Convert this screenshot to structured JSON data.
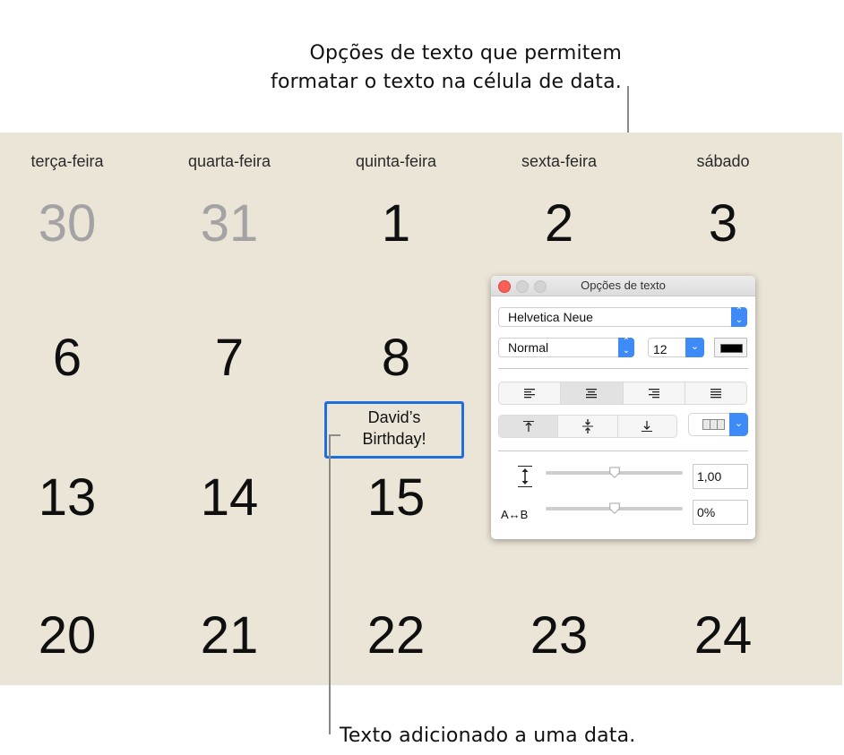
{
  "annotations": {
    "top_callout_line1": "Opções de texto que permitem",
    "top_callout_line2": "formatar o texto na célula de data.",
    "bottom_callout": "Texto adicionado a uma data."
  },
  "calendar": {
    "weekdays": [
      "terça-feira",
      "quarta-feira",
      "quinta-feira",
      "sexta-feira",
      "sábado"
    ],
    "weeks": [
      [
        {
          "day": "30",
          "dim": true
        },
        {
          "day": "31",
          "dim": true
        },
        {
          "day": "1"
        },
        {
          "day": "2"
        },
        {
          "day": "3"
        }
      ],
      [
        {
          "day": "6"
        },
        {
          "day": "7"
        },
        {
          "day": "8"
        },
        {
          "day": ""
        },
        {
          "day": ""
        }
      ],
      [
        {
          "day": "13"
        },
        {
          "day": "14"
        },
        {
          "day": "15"
        },
        {
          "day": ""
        },
        {
          "day": ""
        }
      ],
      [
        {
          "day": "20"
        },
        {
          "day": "21"
        },
        {
          "day": "22"
        },
        {
          "day": "23"
        },
        {
          "day": "24"
        }
      ]
    ],
    "selected_cell_text_line1": "David’s",
    "selected_cell_text_line2": "Birthday!",
    "background_color": "#ebe5d7",
    "selection_color": "#1c6fdc"
  },
  "text_options_panel": {
    "title": "Opções de texto",
    "font_family": "Helvetica Neue",
    "font_style": "Normal",
    "font_size": "12",
    "text_color": "#000000",
    "horizontal_alignment": {
      "options": [
        "align-left",
        "align-center",
        "align-right",
        "justify"
      ],
      "selected": "align-center"
    },
    "vertical_alignment": {
      "options": [
        "align-top",
        "align-middle",
        "align-bottom"
      ],
      "selected": "align-top"
    },
    "columns_icon": "columns-icon",
    "line_spacing": {
      "icon": "line-spacing-icon",
      "value": "1,00",
      "slider_fraction": 0.5
    },
    "character_spacing": {
      "label": "A↔B",
      "value": "0%",
      "slider_fraction": 0.5
    }
  }
}
